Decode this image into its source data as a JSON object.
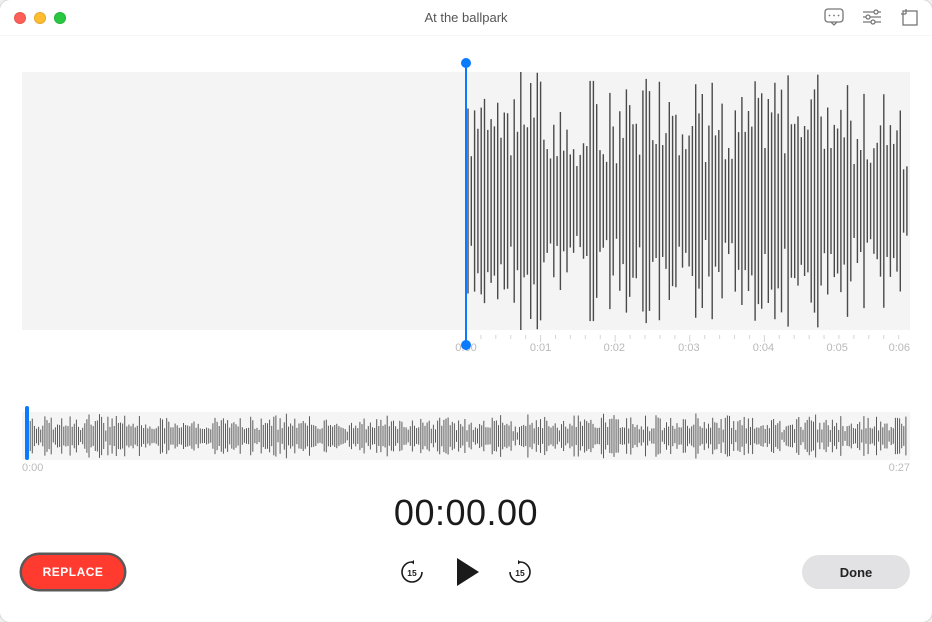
{
  "window": {
    "title": "At the ballpark"
  },
  "toolbar": {
    "transcribe_icon": "transcribe-icon",
    "settings_icon": "playback-settings-icon",
    "trim_icon": "trim-icon"
  },
  "main_waveform": {
    "playhead_pct": 50,
    "ruler_labels": [
      "0:00",
      "0:01",
      "0:02",
      "0:03",
      "0:04",
      "0:05",
      "0:06"
    ],
    "ruler_positions_pct": [
      50.0,
      58.4,
      66.7,
      75.1,
      83.5,
      91.8,
      100
    ]
  },
  "overview": {
    "cursor_pct": 0.3,
    "start_label": "0:00",
    "end_label": "0:27"
  },
  "timer": "00:00.00",
  "controls": {
    "replace_label": "REPLACE",
    "skip_back_seconds": "15",
    "skip_fwd_seconds": "15",
    "done_label": "Done"
  },
  "colors": {
    "accent_blue": "#0a7aff",
    "replace_red": "#ff3b30"
  }
}
